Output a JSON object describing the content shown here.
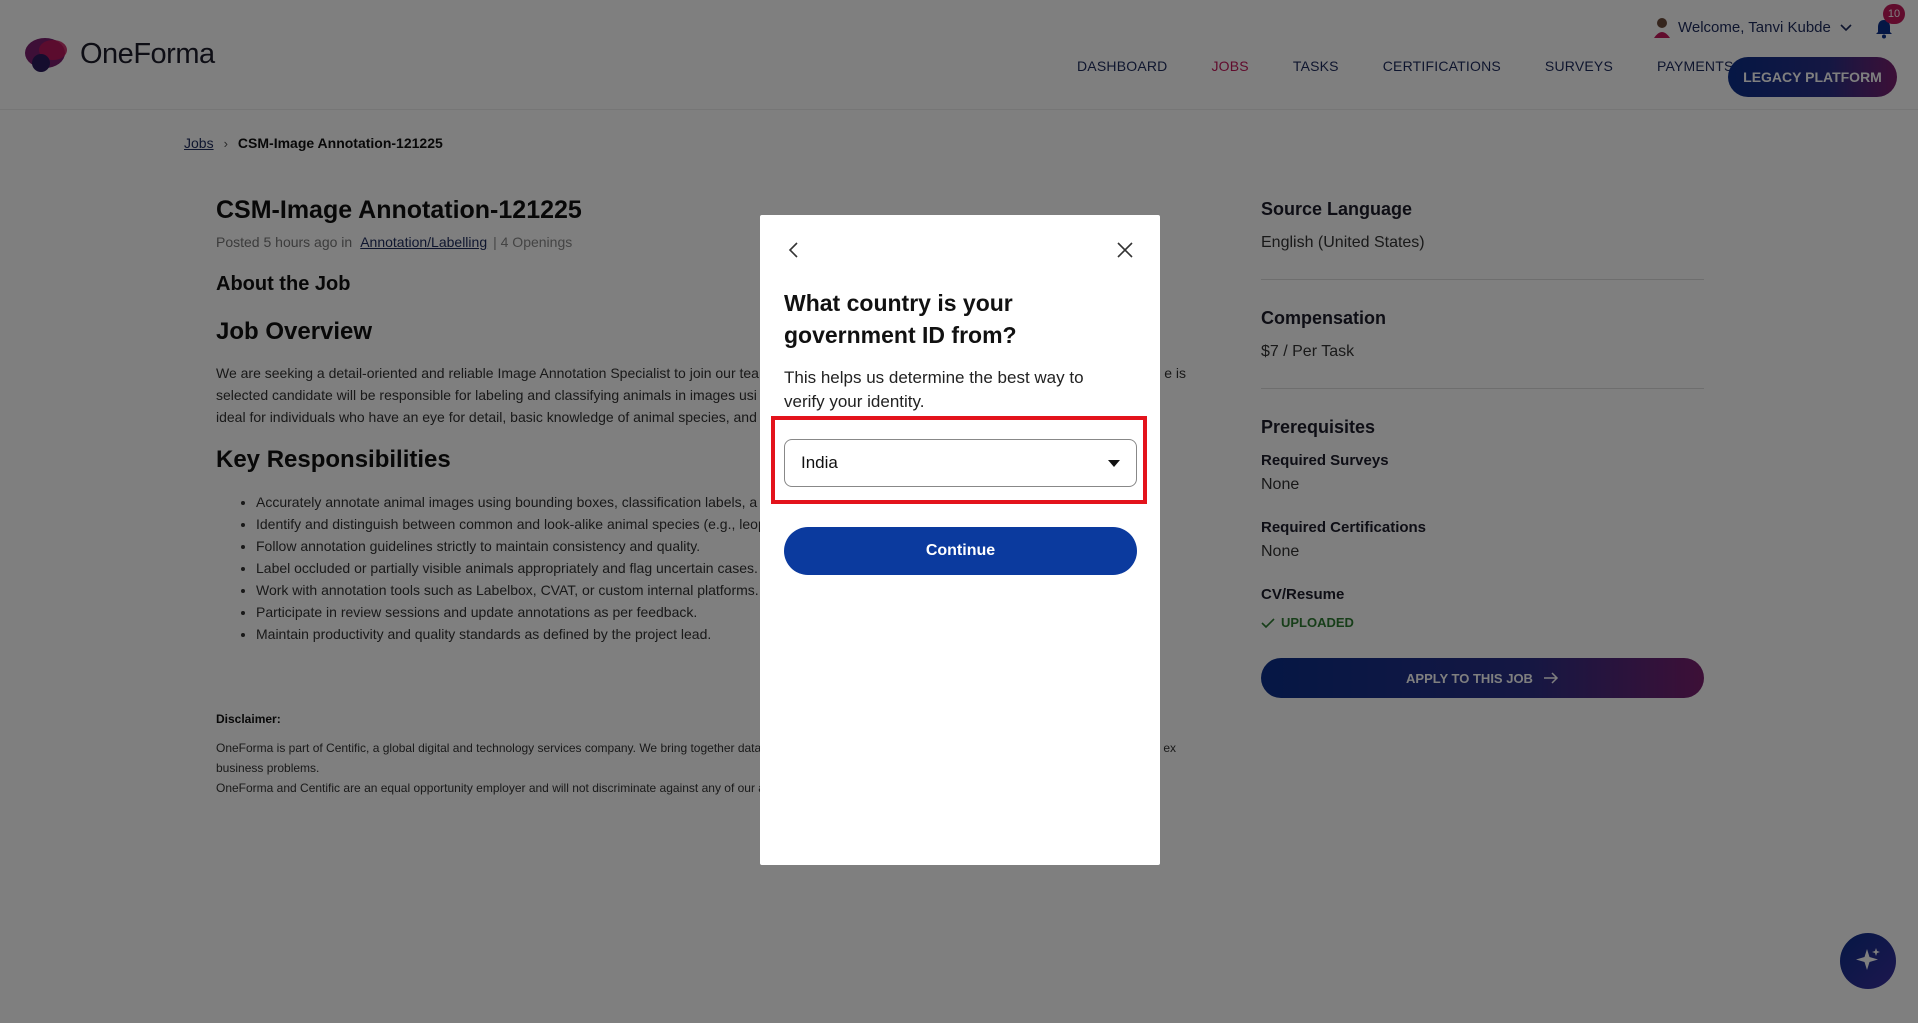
{
  "header": {
    "logo_text": "OneForma",
    "welcome_text": "Welcome, Tanvi Kubde",
    "notification_count": "10",
    "nav_items": [
      {
        "label": "DASHBOARD"
      },
      {
        "label": "JOBS"
      },
      {
        "label": "TASKS"
      },
      {
        "label": "CERTIFICATIONS"
      },
      {
        "label": "SURVEYS"
      },
      {
        "label": "PAYMENTS"
      }
    ],
    "legacy_button": "LEGACY PLATFORM"
  },
  "breadcrumb": {
    "root": "Jobs",
    "current": "CSM-Image Annotation-121225"
  },
  "job": {
    "title": "CSM-Image Annotation-121225",
    "posted_prefix": "Posted 5 hours ago in",
    "category": "Annotation/Labelling",
    "openings": "| 4 Openings",
    "about_heading": "About the Job",
    "overview_heading": "Job Overview",
    "description_line1": "We are seeking a detail-oriented and reliable Image Annotation Specialist to join our team",
    "description_line1_end": "e is",
    "description_line2": "selected candidate will be responsible for labeling and classifying animals in images usi",
    "description_line3": "ideal for individuals who have an eye for detail, basic knowledge of animal species, and c",
    "responsibilities_heading": "Key Responsibilities",
    "responsibilities": [
      "Accurately annotate animal images using bounding boxes, classification labels, a",
      "Identify and distinguish between common and look-alike animal species (e.g., leop",
      "Follow annotation guidelines strictly to maintain consistency and quality.",
      "Label occluded or partially visible animals appropriately and flag uncertain cases.",
      "Work with annotation tools such as Labelbox, CVAT, or custom internal platforms.",
      "Participate in review sessions and update annotations as per feedback.",
      "Maintain productivity and quality standards as defined by the project lead."
    ]
  },
  "disclaimer": {
    "title": "Disclaimer:",
    "line1": "OneForma is part of Centific, a global digital and technology services company. We bring together data",
    "line1_end": "ex",
    "line2": "business problems.",
    "line3": "OneForma and Centific are an equal opportunity employer and will not discriminate against any of our a"
  },
  "sidebar": {
    "source_language_label": "Source Language",
    "source_language_value": "English (United States)",
    "compensation_label": "Compensation",
    "compensation_value": "$7 / Per Task",
    "prerequisites_label": "Prerequisites",
    "required_surveys_label": "Required Surveys",
    "required_surveys_value": "None",
    "required_certifications_label": "Required Certifications",
    "required_certifications_value": "None",
    "cv_label": "CV/Resume",
    "cv_status": "UPLOADED",
    "apply_button": "APPLY TO THIS JOB"
  },
  "modal": {
    "title": "What country is your government ID from?",
    "subtitle": "This helps us determine the best way to verify your identity.",
    "country_selected": "India",
    "continue_button": "Continue"
  },
  "colors": {
    "brand_blue": "#0b3a9e",
    "brand_magenta": "#c2185b",
    "highlight_red": "#e3131c"
  }
}
